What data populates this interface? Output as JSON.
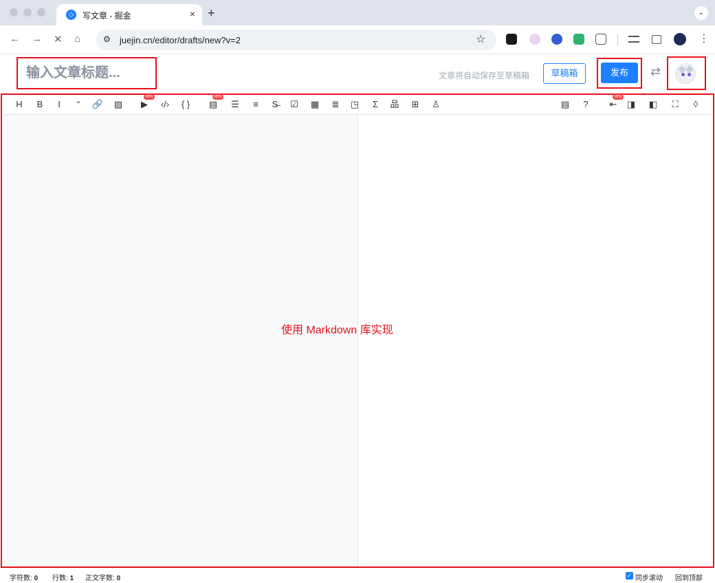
{
  "browser": {
    "tab_title": "写文章 - 掘金",
    "tab_close": "×",
    "new_tab": "+",
    "tab_menu": "⌄",
    "url": "juejin.cn/editor/drafts/new?v=2",
    "nav": {
      "back": "←",
      "forward": "→",
      "stop": "✕",
      "home": "⌂"
    },
    "star": "☆",
    "kebab": "⋮"
  },
  "header": {
    "title_placeholder": "输入文章标题...",
    "autosave_text": "文章将自动保存至草稿箱",
    "draft_label": "草稿箱",
    "publish_label": "发布",
    "swap_icon": "⇄"
  },
  "toolbar": {
    "left": [
      {
        "name": "heading-icon",
        "glyph": "H"
      },
      {
        "name": "bold-icon",
        "glyph": "B"
      },
      {
        "name": "italic-icon",
        "glyph": "I"
      },
      {
        "name": "quote-icon",
        "glyph": "“"
      },
      {
        "name": "link-icon",
        "glyph": "🔗"
      },
      {
        "name": "image-icon",
        "glyph": "▨"
      },
      {
        "name": "video-icon",
        "glyph": "▶",
        "badge": "NEW"
      },
      {
        "name": "code-icon",
        "glyph": "‹/›"
      },
      {
        "name": "code-block-icon",
        "glyph": "{ }"
      },
      {
        "name": "embed-icon",
        "glyph": "▤",
        "badge": "NEW"
      },
      {
        "name": "unordered-list-icon",
        "glyph": "☰"
      },
      {
        "name": "ordered-list-icon",
        "glyph": "≡"
      },
      {
        "name": "strikethrough-icon",
        "glyph": "S̶"
      },
      {
        "name": "task-list-icon",
        "glyph": "☑"
      },
      {
        "name": "table-icon",
        "glyph": "▦"
      },
      {
        "name": "align-icon",
        "glyph": "≣"
      },
      {
        "name": "insert-icon",
        "glyph": "◳"
      },
      {
        "name": "formula-icon",
        "glyph": "Σ"
      },
      {
        "name": "flowchart-icon",
        "glyph": "品"
      },
      {
        "name": "grid-icon",
        "glyph": "⊞"
      },
      {
        "name": "theme-icon",
        "glyph": "♙"
      }
    ],
    "right": [
      {
        "name": "toc-icon",
        "glyph": "▤"
      },
      {
        "name": "help-icon",
        "glyph": "?"
      },
      {
        "name": "sync-toggle-icon",
        "glyph": "⇤",
        "badge": "NEW"
      },
      {
        "name": "preview-only-icon",
        "glyph": "◨"
      },
      {
        "name": "edit-only-icon",
        "glyph": "◧"
      },
      {
        "name": "fullscreen-icon",
        "glyph": "⛶"
      },
      {
        "name": "github-icon",
        "glyph": "◊"
      }
    ]
  },
  "annotation": "使用 Markdown 库实现",
  "status": {
    "char_label": "字符数:",
    "char_value": "0",
    "line_label": "行数:",
    "line_value": "1",
    "body_label": "正文字数:",
    "body_value": "0",
    "sync_label": "同步滚动",
    "back_to_top": "回到顶部"
  },
  "colors": {
    "accent": "#1e80ff",
    "annotation_red": "#e8101c",
    "badge": "#f53f3f"
  }
}
